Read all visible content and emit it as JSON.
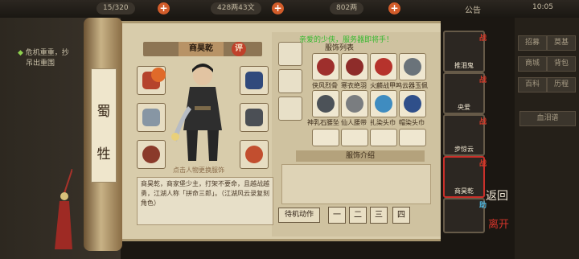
{
  "top": {
    "stamina": "15/320",
    "silver": "428两43文",
    "gold": "802两",
    "announcement": "公告",
    "time": "10:05"
  },
  "quest": {
    "line1": "危机重重，抄",
    "line2": "吊出重围"
  },
  "right_menu": [
    "招募",
    "莫基",
    "商城",
    "背包",
    "百科",
    "历程"
  ],
  "right_tab": "血泪谱",
  "scroll_label": [
    "蜀",
    "牲"
  ],
  "character": {
    "name": "商昊乾",
    "rating": "评"
  },
  "hint": "点击人物更换服饰",
  "description": "商昊乾，商家堡少主，打架不要命，且越战越勇，江湖人称「拼命三郎」。（江湖风云录复刻角色）",
  "notice": "亲爱的少侠，服务器即将手！",
  "wardrobe_title": "服饰列表",
  "items_row1": [
    "侠风烈骨",
    "寒衣绝羽",
    "火麟战甲",
    "鸣云器玉佩"
  ],
  "items_row2": [
    "神乳石腰坠",
    "仙人腰带",
    "扎染头巾",
    "帽染头巾"
  ],
  "intro_title": "服饰介绍",
  "idle_action": "待机动作",
  "pose_buttons": [
    "一",
    "二",
    "三",
    "四"
  ],
  "portraits": [
    {
      "name": "推泪鬼",
      "tag": "战"
    },
    {
      "name": "央爱",
      "tag": "战"
    },
    {
      "name": "步惊云",
      "tag": "战"
    },
    {
      "name": "商昊乾",
      "tag": "战"
    },
    {
      "name": "",
      "tag": "助"
    }
  ],
  "back_label": "返回",
  "home_label": "离开",
  "colors": {
    "accent_red": "#d33a2a",
    "notice_green": "#35b92e",
    "parchment": "#d8ccab"
  }
}
